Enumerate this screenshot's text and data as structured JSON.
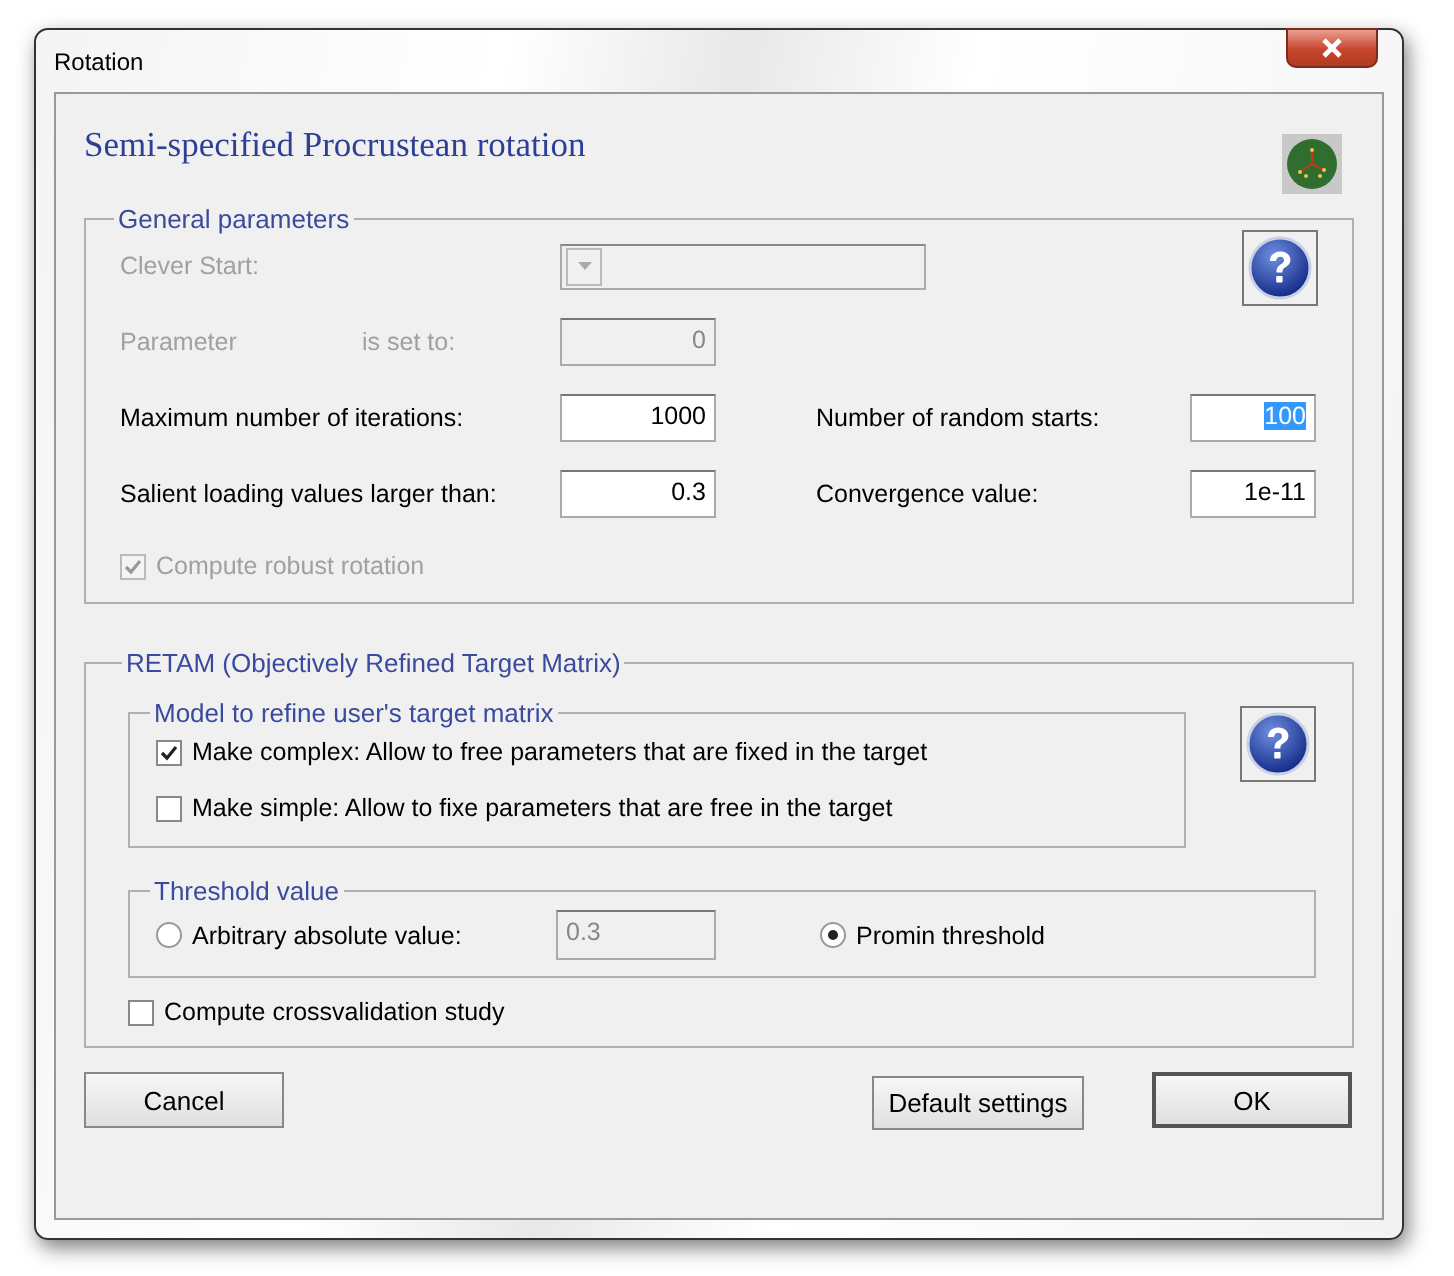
{
  "window": {
    "title": "Rotation"
  },
  "header": {
    "title": "Semi-specified Procrustean rotation"
  },
  "general": {
    "legend": "General parameters",
    "clever_start": {
      "label": "Clever Start:",
      "disabled": true
    },
    "parameter": {
      "label": "Parameter",
      "suffix": "is set to:",
      "value": "0",
      "disabled": true
    },
    "fields": [
      {
        "label": "Maximum number of iterations:",
        "value": "1000",
        "highlighted": false
      },
      {
        "label": "Number of random starts:",
        "value": "100",
        "highlighted": true
      },
      {
        "label": "Salient loading values larger than:",
        "value": "0.3",
        "highlighted": false
      },
      {
        "label": "Convergence value:",
        "value": "1e-11",
        "highlighted": false
      }
    ],
    "robust": {
      "label": "Compute robust rotation",
      "checked": true,
      "disabled": true
    }
  },
  "retam": {
    "legend": "RETAM (Objectively Refined Target Matrix)",
    "model": {
      "legend": "Model to refine user's target matrix",
      "options": [
        {
          "label": "Make complex: Allow to free parameters that are fixed in the target",
          "checked": true
        },
        {
          "label": "Make simple: Allow to fixe parameters that are free in the target",
          "checked": false
        }
      ]
    },
    "threshold": {
      "legend": "Threshold value",
      "options": [
        {
          "kind": "value",
          "label": "Arbitrary absolute value:",
          "selected": false,
          "value": "0.3",
          "disabled": true
        },
        {
          "kind": "plain",
          "label": "Promin threshold",
          "selected": true
        }
      ]
    },
    "crossvalidation": {
      "label": "Compute crossvalidation study",
      "checked": false
    }
  },
  "buttons": [
    {
      "label": "Cancel",
      "default": false
    },
    {
      "label": "Default settings",
      "default": false
    },
    {
      "label": "OK",
      "default": true
    }
  ]
}
